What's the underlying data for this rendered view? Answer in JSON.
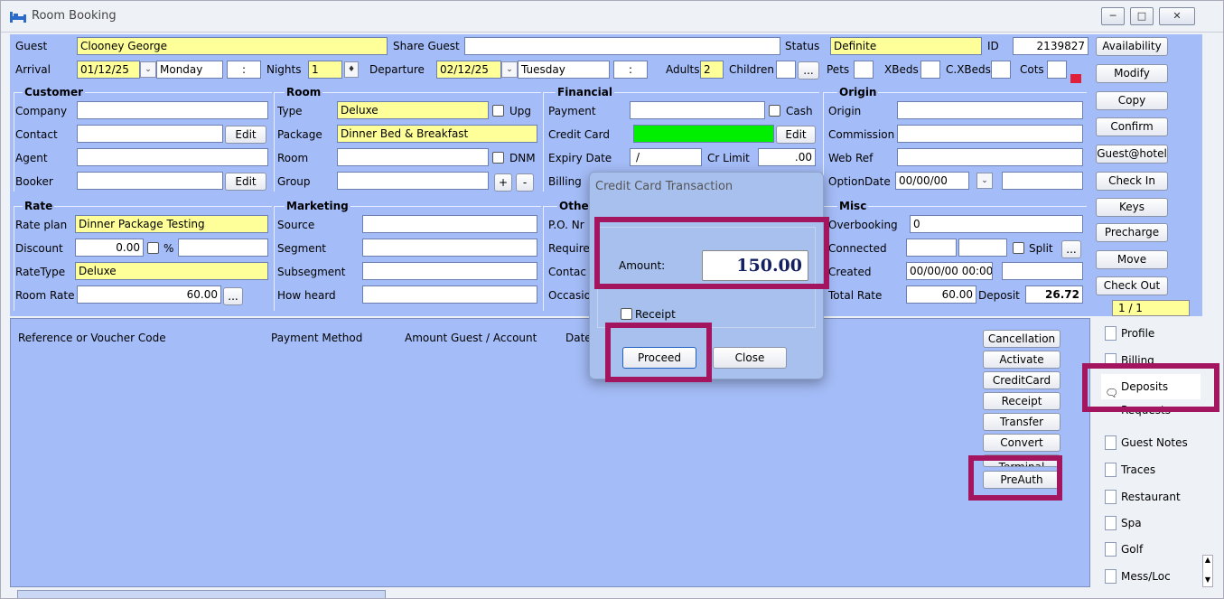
{
  "window": {
    "title": "Room Booking"
  },
  "guest": {
    "guest_label": "Guest",
    "guest_value": "Clooney George",
    "share_label": "Share Guest",
    "share_value": "",
    "status_label": "Status",
    "status_value": "Definite",
    "id_label": "ID",
    "id_value": "2139827"
  },
  "stay": {
    "arrival_label": "Arrival",
    "arrival_date": "01/12/25",
    "arrival_day": "Monday",
    "arrival_time": ":",
    "nights_label": "Nights",
    "nights_value": "1",
    "departure_label": "Departure",
    "departure_date": "02/12/25",
    "departure_day": "Tuesday",
    "departure_time": ":",
    "adults_label": "Adults",
    "adults_value": "2",
    "children_label": "Children",
    "ellipsis": "...",
    "pets_label": "Pets",
    "xbeds_label": "XBeds",
    "cxbeds_label": "C.XBeds",
    "cots_label": "Cots"
  },
  "customer": {
    "title": "Customer",
    "company_label": "Company",
    "contact_label": "Contact",
    "contact_edit": "Edit",
    "agent_label": "Agent",
    "booker_label": "Booker",
    "booker_edit": "Edit"
  },
  "room": {
    "title": "Room",
    "type_label": "Type",
    "type_value": "Deluxe",
    "upg_label": "Upg",
    "package_label": "Package",
    "package_value": "Dinner Bed & Breakfast",
    "room_label": "Room",
    "dnm_label": "DNM",
    "group_label": "Group",
    "plus": "+",
    "minus": "-"
  },
  "financial": {
    "title": "Financial",
    "payment_label": "Payment",
    "cash_label": "Cash",
    "cc_label": "Credit Card",
    "cc_edit": "Edit",
    "expiry_label": "Expiry Date",
    "expiry_value": "/",
    "crlimit_label": "Cr Limit",
    "crlimit_value": ".00",
    "billing_label": "Billing"
  },
  "origin": {
    "title": "Origin",
    "origin_label": "Origin",
    "commission_label": "Commission",
    "webref_label": "Web Ref",
    "optiondate_label": "OptionDate",
    "optiondate_value": "00/00/00"
  },
  "rate": {
    "title": "Rate",
    "rateplan_label": "Rate plan",
    "rateplan_value": "Dinner Package Testing",
    "discount_label": "Discount",
    "discount_value": "0.00",
    "pct": "%",
    "ratetype_label": "RateType",
    "ratetype_value": "Deluxe",
    "roomrate_label": "Room Rate",
    "roomrate_value": "60.00",
    "ellipsis": "..."
  },
  "marketing": {
    "title": "Marketing",
    "source_label": "Source",
    "segment_label": "Segment",
    "subsegment_label": "Subsegment",
    "howheard_label": "How heard"
  },
  "other": {
    "title": "Othe",
    "po_label": "P.O. Nr",
    "required_label": "Require",
    "contact_label": "Contac",
    "occasion_label": "Occasio"
  },
  "misc": {
    "title": "Misc",
    "overbooking_label": "Overbooking",
    "overbooking_value": "0",
    "connected_label": "Connected",
    "split_label": "Split",
    "ellipsis": "...",
    "created_label": "Created",
    "created_value": "00/00/00 00:00",
    "totalrate_label": "Total Rate",
    "totalrate_value": "60.00",
    "deposit_label": "Deposit",
    "deposit_value": "26.72"
  },
  "sidebar": {
    "buttons": [
      "Availability",
      "Modify",
      "Copy",
      "Confirm",
      "Guest@hotel",
      "Check In",
      "Keys",
      "Precharge",
      "Move",
      "Check Out"
    ],
    "pager": "1 / 1"
  },
  "ledger": {
    "columns": [
      "Reference or Voucher Code",
      "Payment Method",
      "Amount Guest / Account",
      "Date"
    ],
    "actions": [
      "Cancellation",
      "Activate",
      "CreditCard",
      "Receipt",
      "Transfer",
      "Convert",
      "Terminal",
      "PreAuth"
    ]
  },
  "tabs": [
    "Profile",
    "Billing",
    "Deposits",
    "Requests",
    "Guest Notes",
    "Traces",
    "Restaurant",
    "Spa",
    "Golf",
    "Mess/Loc"
  ],
  "dialog": {
    "title": "Credit Card Transaction",
    "amount_label": "Amount:",
    "amount_value": "150.00",
    "receipt_label": "Receipt",
    "proceed_label": "Proceed",
    "close_label": "Close"
  },
  "colors": {
    "form_bg": "#a4bcf7",
    "highlight": "#a3165f",
    "yellow": "#ffff99",
    "green": "#00ee00"
  }
}
